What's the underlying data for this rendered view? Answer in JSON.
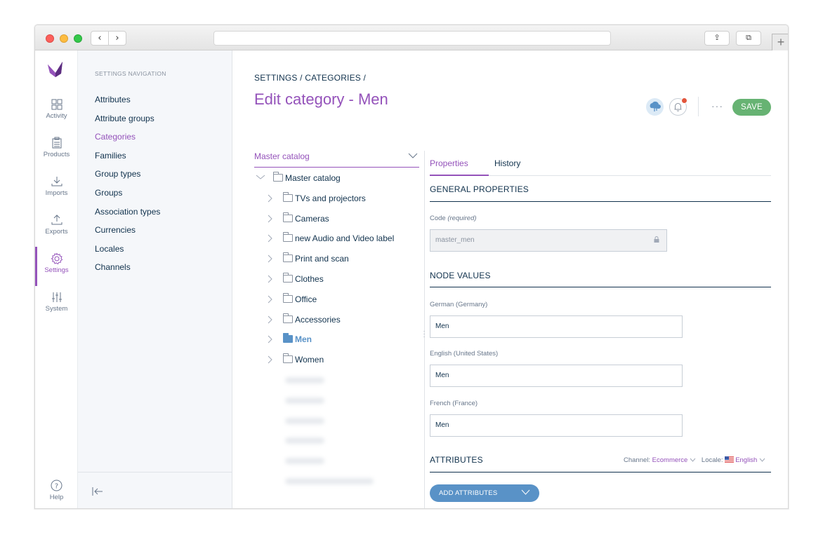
{
  "window": {
    "back_glyph": "‹",
    "forward_glyph": "›",
    "share_glyph": "⇪",
    "tabs_glyph": "⧉",
    "newtab_glyph": "+"
  },
  "rail": {
    "items": [
      {
        "label": "Activity",
        "icon": "activity-icon"
      },
      {
        "label": "Products",
        "icon": "products-icon"
      },
      {
        "label": "Imports",
        "icon": "imports-icon"
      },
      {
        "label": "Exports",
        "icon": "exports-icon"
      },
      {
        "label": "Settings",
        "icon": "settings-icon",
        "active": true
      },
      {
        "label": "System",
        "icon": "system-icon"
      }
    ],
    "help_label": "Help",
    "accent_color": "#9452ba"
  },
  "subnav": {
    "title": "SETTINGS NAVIGATION",
    "items": [
      "Attributes",
      "Attribute groups",
      "Categories",
      "Families",
      "Group types",
      "Groups",
      "Association types",
      "Currencies",
      "Locales",
      "Channels"
    ],
    "active_index": 2
  },
  "header": {
    "breadcrumb": "SETTINGS / CATEGORIES /",
    "title": "Edit category - Men",
    "more_label": "···",
    "save_label": "SAVE",
    "save_color": "#67b373"
  },
  "tree": {
    "selector_label": "Master catalog",
    "root": "Master catalog",
    "children": [
      "TVs and projectors",
      "Cameras",
      "new Audio and Video label",
      "Print and scan",
      "Clothes",
      "Office",
      "Accessories",
      "Men",
      "Women"
    ],
    "selected_index": 7,
    "arrow_collapsed": "›",
    "arrow_expanded": "⌄"
  },
  "panel": {
    "tabs": [
      "Properties",
      "History"
    ],
    "general_title": "GENERAL PROPERTIES",
    "code_label": "Code",
    "code_required": "(required)",
    "code_value": "master_men",
    "node_values_title": "NODE VALUES",
    "locales": [
      {
        "label": "German (Germany)",
        "value": "Men"
      },
      {
        "label": "English (United States)",
        "value": "Men"
      },
      {
        "label": "French (France)",
        "value": "Men"
      }
    ],
    "attributes_title": "ATTRIBUTES",
    "channel_label": "Channel:",
    "channel_value": "Ecommerce",
    "locale_label": "Locale:",
    "locale_value": "English",
    "add_attributes_label": "ADD ATTRIBUTES",
    "add_color": "#5992c7"
  }
}
